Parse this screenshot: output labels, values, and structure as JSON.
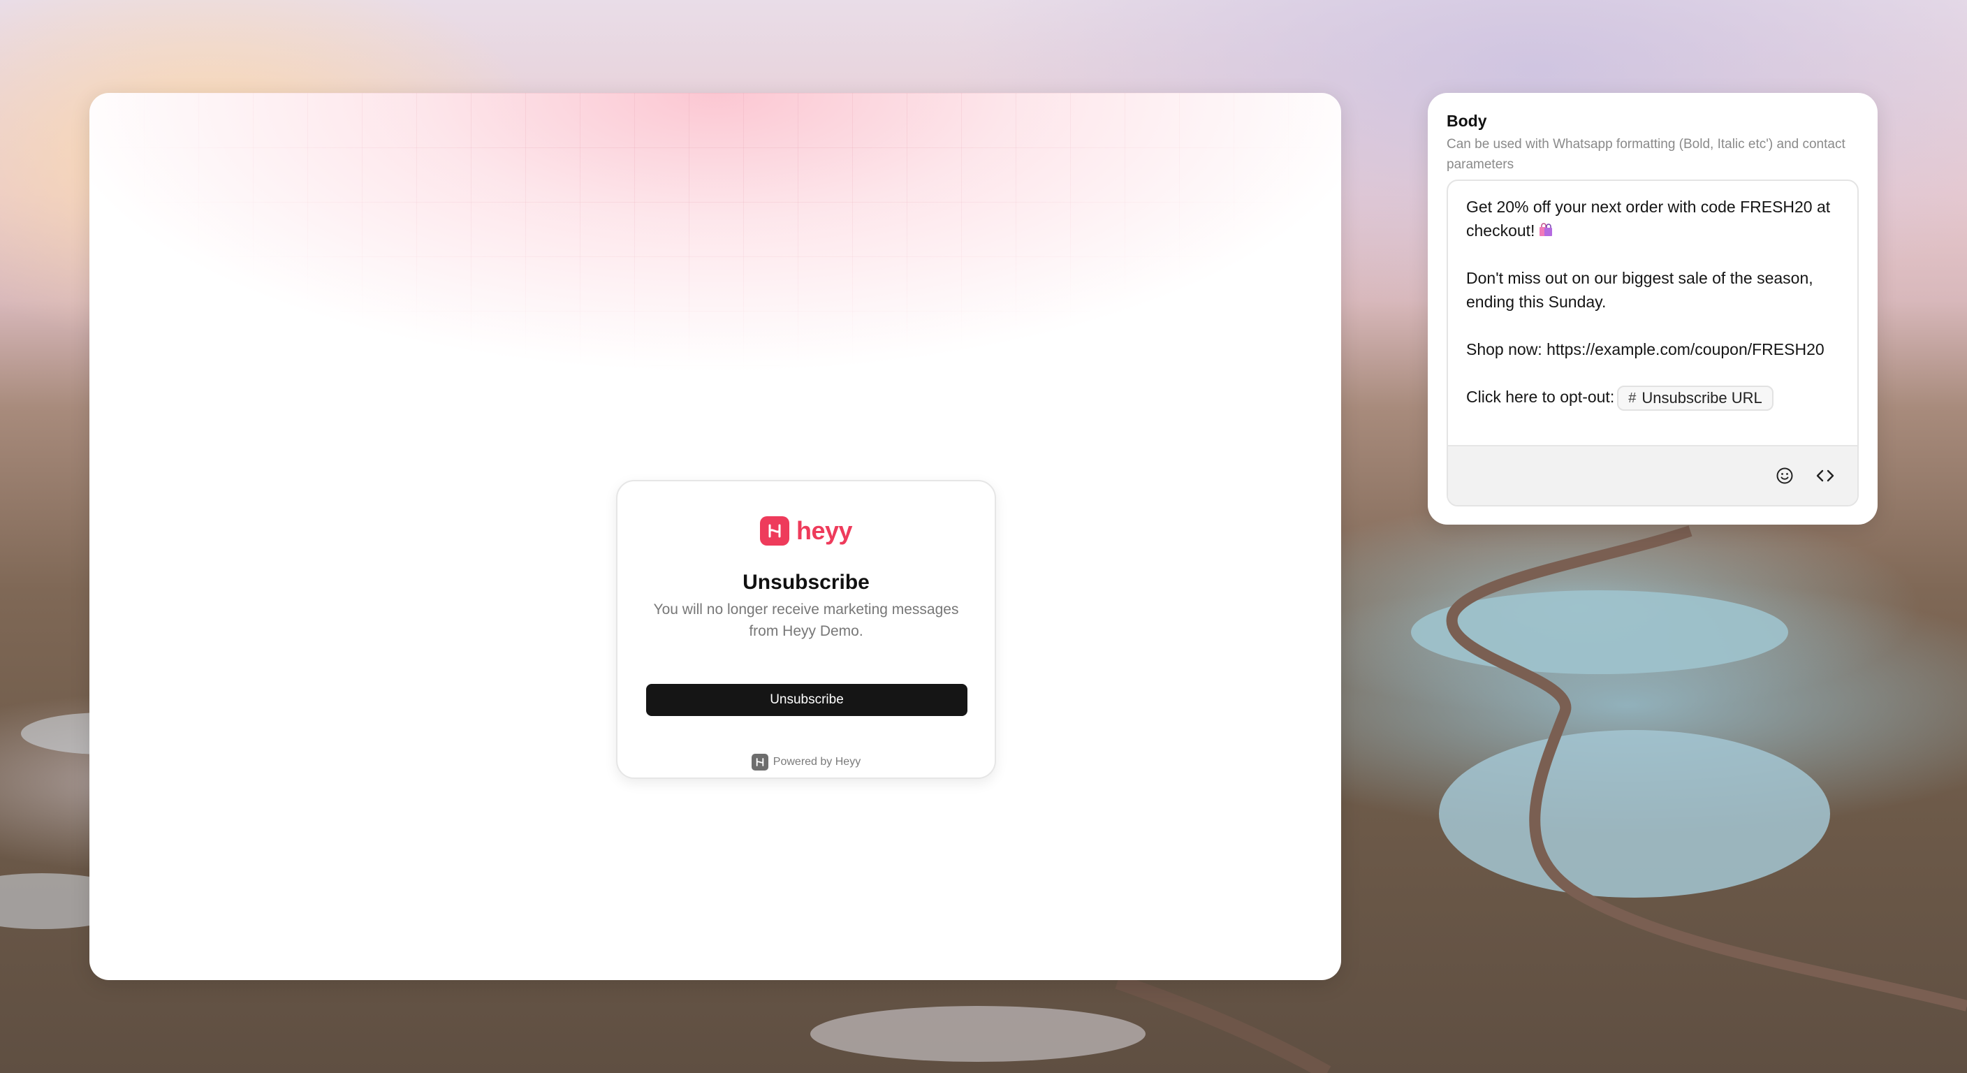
{
  "preview": {
    "brand": {
      "name": "heyy"
    },
    "unsubscribe_card": {
      "title": "Unsubscribe",
      "description": "You will no longer receive marketing messages from Heyy Demo.",
      "button_label": "Unsubscribe",
      "footer": "Powered by Heyy"
    },
    "accent_color": "#ee3b5b"
  },
  "editor": {
    "label": "Body",
    "help_text": "Can be used with Whatsapp formatting (Bold, Italic etc') and contact parameters",
    "lines": [
      "Get 20% off your next order with code FRESH20 at checkout!",
      "Don't miss out on our biggest sale of the season, ending this Sunday.",
      "Shop now: https://example.com/coupon/FRESH20",
      "Click here to opt-out:"
    ],
    "line1_icon": "shopping-bags-emoji",
    "parameter_chip": {
      "icon": "hash-icon",
      "label": "Unsubscribe URL"
    },
    "toolbar": {
      "emoji_icon": "smiley-icon",
      "code_icon": "code-brackets-icon"
    }
  }
}
